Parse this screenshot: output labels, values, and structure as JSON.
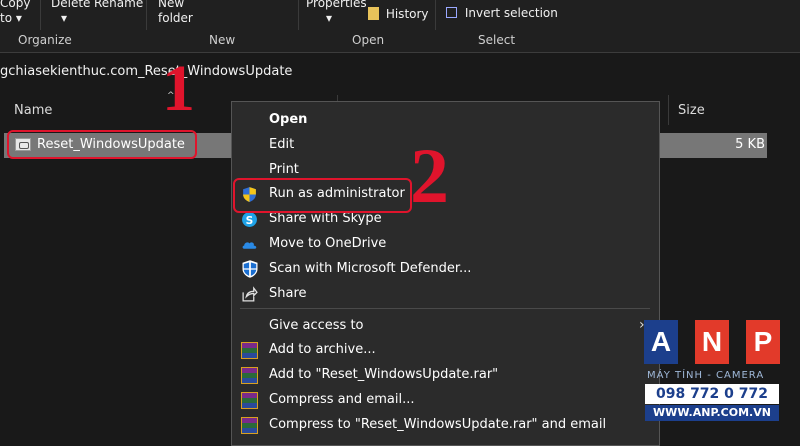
{
  "ribbon": {
    "copy_to": "Copy\nto",
    "copy_label": "Copy",
    "to_label": "to ▾",
    "delete_label": "Delete",
    "delete_arrow": "▾",
    "rename_label": "Rename",
    "new_folder_1": "New",
    "new_folder_2": "folder",
    "properties_label": "Properties",
    "properties_arrow": "▾",
    "history_label": "History",
    "invert_selection_label": "Invert selection",
    "groups": {
      "organize": "Organize",
      "new": "New",
      "open": "Open",
      "select": "Select"
    }
  },
  "address": {
    "path": "gchiasekienthuc.com_Reset_WindowsUpdate"
  },
  "columns": {
    "name": "Name",
    "size": "Size"
  },
  "file": {
    "name": "Reset_WindowsUpdate",
    "size": "5 KB"
  },
  "annotations": {
    "step1": "1",
    "step2": "2"
  },
  "context_menu": {
    "items": [
      {
        "label": "Open",
        "icon": "none",
        "bold": true
      },
      {
        "label": "Edit",
        "icon": "none"
      },
      {
        "label": "Print",
        "icon": "none"
      },
      {
        "label": "Run as administrator",
        "icon": "uac-shield-icon"
      },
      {
        "label": "Share with Skype",
        "icon": "skype-icon"
      },
      {
        "label": "Move to OneDrive",
        "icon": "onedrive-icon"
      },
      {
        "label": "Scan with Microsoft Defender...",
        "icon": "defender-icon"
      },
      {
        "label": "Share",
        "icon": "share-icon"
      },
      {
        "label": "Give access to",
        "icon": "none",
        "submenu": true
      },
      {
        "label": "Add to archive...",
        "icon": "winrar-icon"
      },
      {
        "label": "Add to \"Reset_WindowsUpdate.rar\"",
        "icon": "winrar-icon"
      },
      {
        "label": "Compress and email...",
        "icon": "winrar-icon"
      },
      {
        "label": "Compress to \"Reset_WindowsUpdate.rar\" and email",
        "icon": "winrar-icon"
      }
    ]
  },
  "watermark": {
    "letters": [
      "A",
      "N",
      "P"
    ],
    "subtitle": "MÁY TÍNH - CAMERA",
    "phone": "098 772 0 772",
    "website": "WWW.ANP.COM.VN",
    "colors": {
      "a": "#1c3f8c",
      "n": "#e23a2a",
      "p": "#e23a2a"
    }
  },
  "colors": {
    "background": "#191919",
    "ribbon": "#202020",
    "menu": "#2b2b2b",
    "selection": "#777777",
    "annotation_red": "#e0142c"
  }
}
